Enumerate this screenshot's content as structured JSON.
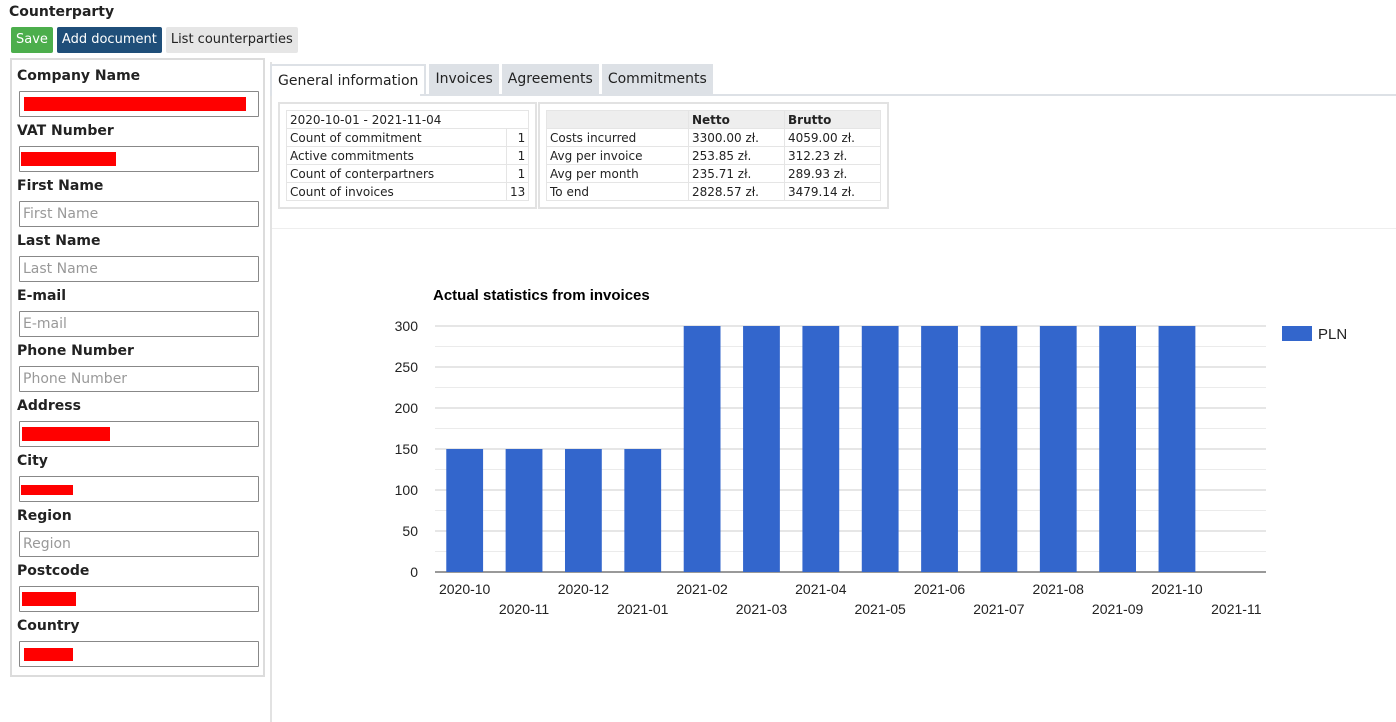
{
  "page": {
    "title": "Counterparty"
  },
  "toolbar": {
    "save_label": "Save",
    "add_document_label": "Add document",
    "list_counterparties_label": "List counterparties"
  },
  "form": {
    "company_name": {
      "label": "Company Name",
      "value": ""
    },
    "vat_number": {
      "label": "VAT Number",
      "value": ""
    },
    "first_name": {
      "label": "First Name",
      "placeholder": "First Name",
      "value": ""
    },
    "last_name": {
      "label": "Last Name",
      "placeholder": "Last Name",
      "value": ""
    },
    "email": {
      "label": "E-mail",
      "placeholder": "E-mail",
      "value": ""
    },
    "phone": {
      "label": "Phone Number",
      "placeholder": "Phone Number",
      "value": ""
    },
    "address": {
      "label": "Address",
      "value": ""
    },
    "city": {
      "label": "City",
      "value": ""
    },
    "region": {
      "label": "Region",
      "placeholder": "Region",
      "value": ""
    },
    "postcode": {
      "label": "Postcode",
      "value": ""
    },
    "country": {
      "label": "Country",
      "value": ""
    },
    "redaction_color": "#ff0000"
  },
  "tabs": [
    {
      "label": "General information",
      "active": true
    },
    {
      "label": "Invoices",
      "active": false
    },
    {
      "label": "Agreements",
      "active": false
    },
    {
      "label": "Commitments",
      "active": false
    }
  ],
  "summary": {
    "period": "2020-10-01 - 2021-11-04",
    "rows": [
      {
        "label": "Count of commitment",
        "value": "1"
      },
      {
        "label": "Active commitments",
        "value": "1"
      },
      {
        "label": "Count of conterpartners",
        "value": "1"
      },
      {
        "label": "Count of invoices",
        "value": "13"
      }
    ]
  },
  "costs": {
    "headers": [
      "",
      "Netto",
      "Brutto"
    ],
    "rows": [
      {
        "label": "Costs incurred",
        "netto": "3300.00 zł.",
        "brutto": "4059.00 zł."
      },
      {
        "label": "Avg per invoice",
        "netto": "253.85 zł.",
        "brutto": "312.23 zł."
      },
      {
        "label": "Avg per month",
        "netto": "235.71 zł.",
        "brutto": "289.93 zł."
      },
      {
        "label": "To end",
        "netto": "2828.57 zł.",
        "brutto": "3479.14 zł."
      }
    ]
  },
  "chart_data": {
    "type": "bar",
    "title": "Actual statistics from invoices",
    "categories": [
      "2020-10",
      "2020-11",
      "2020-12",
      "2021-01",
      "2021-02",
      "2021-03",
      "2021-04",
      "2021-05",
      "2021-06",
      "2021-07",
      "2021-08",
      "2021-09",
      "2021-10",
      "2021-11"
    ],
    "series": [
      {
        "name": "PLN",
        "color": "#3366cc",
        "values": [
          150,
          150,
          150,
          150,
          300,
          300,
          300,
          300,
          300,
          300,
          300,
          300,
          300,
          0
        ]
      }
    ],
    "yticks": [
      0,
      50,
      100,
      150,
      200,
      250,
      300
    ],
    "ylim": [
      0,
      300
    ],
    "grid": true,
    "legend_position": "right"
  }
}
